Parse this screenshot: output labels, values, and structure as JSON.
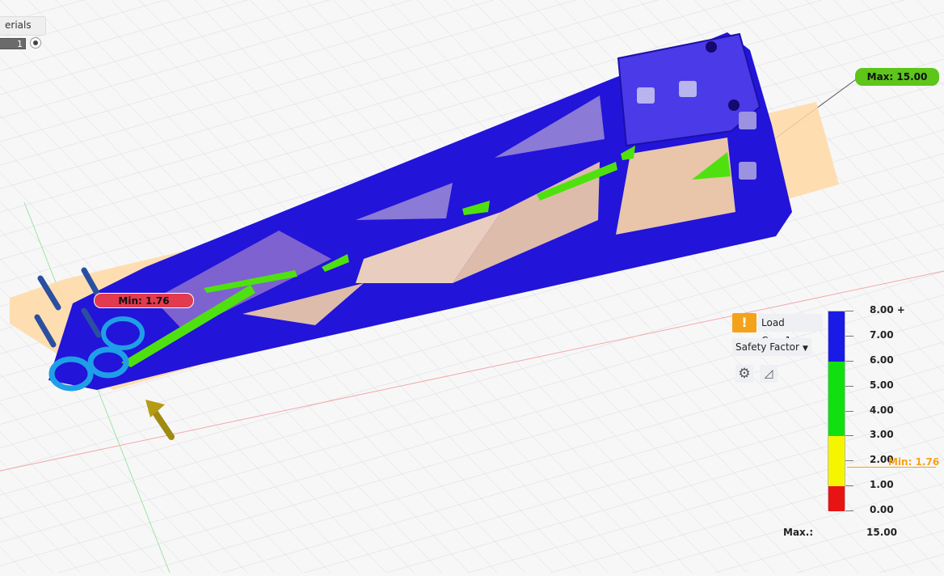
{
  "browser": {
    "tab_label": "erials",
    "case_value": "1"
  },
  "probes": {
    "max_label": "Max: 15.00",
    "min_label": "Min: 1.76"
  },
  "results_panel": {
    "load_case": "Load Case1",
    "result_type": "Safety Factor",
    "icons": {
      "warning": "warning-icon",
      "settings": "gear-icon",
      "probe": "ruler-icon"
    }
  },
  "legend": {
    "ticks": [
      "8.00 +",
      "7.00",
      "6.00",
      "5.00",
      "4.00",
      "3.00",
      "2.00",
      "1.00",
      "0.00"
    ],
    "segments": [
      {
        "from": 6,
        "to": 8,
        "color": "#1a1ae6"
      },
      {
        "from": 3,
        "to": 6,
        "color": "#10e010"
      },
      {
        "from": 1,
        "to": 3,
        "color": "#f5f500"
      },
      {
        "from": 0,
        "to": 1,
        "color": "#e81414"
      }
    ],
    "min_marker_label": "Min: 1.76",
    "min_value": 1.76,
    "max_row_label": "Max.:",
    "max_row_value": "15.00"
  },
  "colors": {
    "accent_orange": "#f5a21b",
    "model_blue": "#2214d8",
    "safe_green": "#4fe10f",
    "alert_red": "#e23a4f"
  }
}
